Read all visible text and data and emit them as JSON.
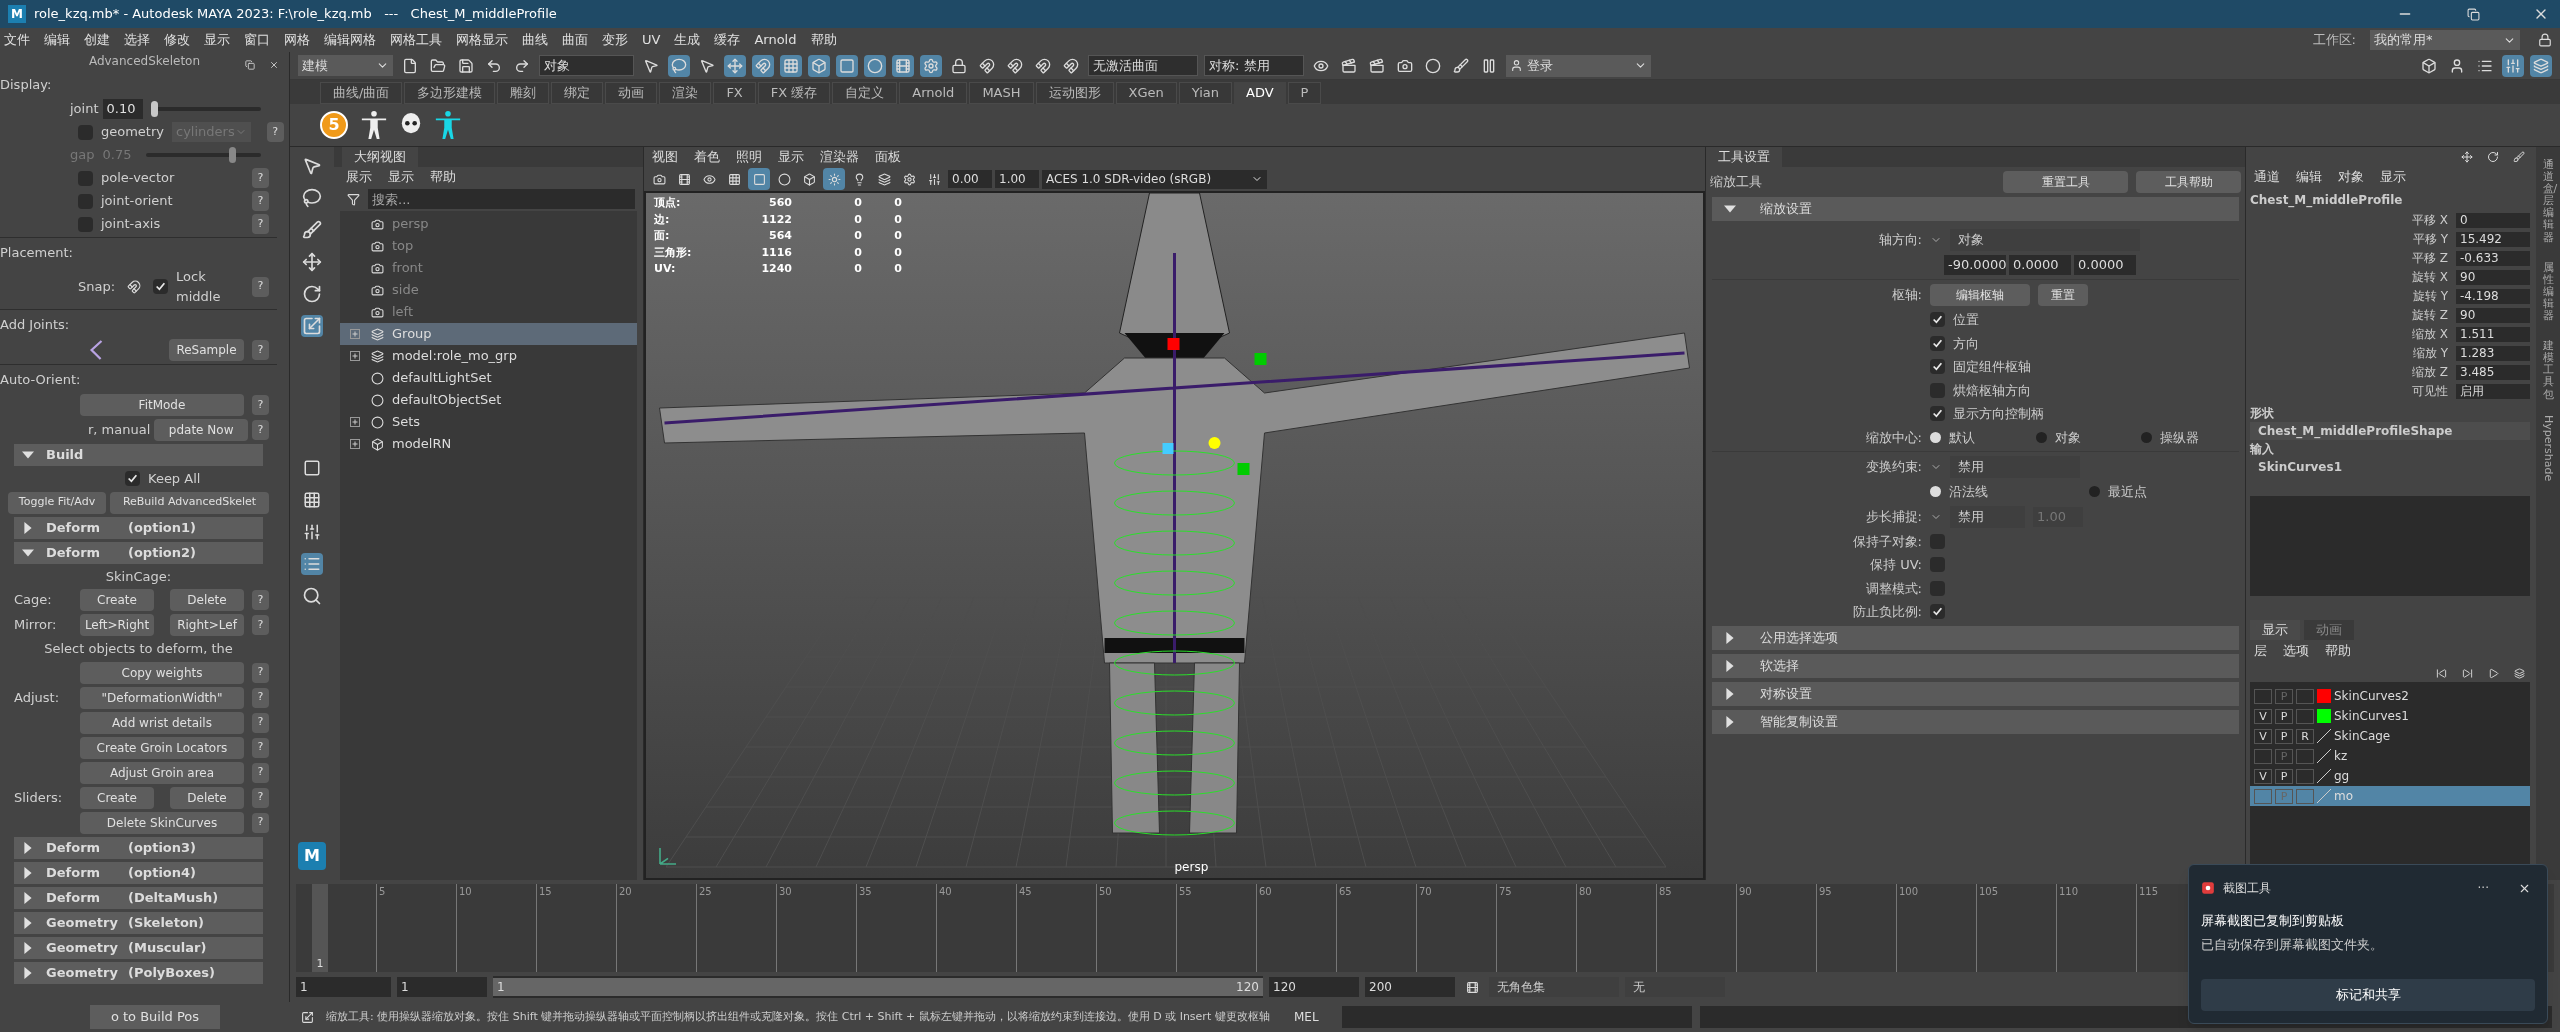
{
  "window": {
    "app_icon": "M",
    "title": "role_kzq.mb* - Autodesk MAYA 2023: F:\\role_kzq.mb   ---   Chest_M_middleProfile"
  },
  "menu_bar": [
    "文件",
    "编辑",
    "创建",
    "选择",
    "修改",
    "显示",
    "窗口",
    "网格",
    "编辑网格",
    "网格工具",
    "网格显示",
    "曲线",
    "曲面",
    "变形",
    "UV",
    "生成",
    "缓存",
    "Arnold",
    "帮助"
  ],
  "workspace": {
    "label": "工作区:",
    "value": "我的常用*"
  },
  "status_line": {
    "mode": "建模",
    "selection_mode": "对象",
    "live_surface": "无激活曲面",
    "symmetry": "对称: 禁用",
    "login": "登录"
  },
  "shelf": {
    "tabs": [
      {
        "label": "曲线/曲面",
        "selected": false
      },
      {
        "label": "多边形建模",
        "selected": false
      },
      {
        "label": "雕刻",
        "selected": false
      },
      {
        "label": "绑定",
        "selected": false
      },
      {
        "label": "动画",
        "selected": false
      },
      {
        "label": "渲染",
        "selected": false
      },
      {
        "label": "FX",
        "selected": false
      },
      {
        "label": "FX 缓存",
        "selected": false
      },
      {
        "label": "自定义",
        "selected": false
      },
      {
        "label": "Arnold",
        "selected": false
      },
      {
        "label": "MASH",
        "selected": false
      },
      {
        "label": "运动图形",
        "selected": false
      },
      {
        "label": "XGen",
        "selected": false
      },
      {
        "label": "Yian",
        "selected": false
      },
      {
        "label": "ADV",
        "selected": true
      },
      {
        "label": "P",
        "selected": false
      }
    ],
    "badge": "5"
  },
  "advanced_skeleton": {
    "title": "AdvancedSkeleton",
    "rows": [
      {
        "kind": "heading",
        "text": "Display:"
      },
      {
        "kind": "slider",
        "label": "joint",
        "value": "0.10",
        "level": 0.03,
        "disabled": false
      },
      {
        "kind": "checkbox_dropdown",
        "label": "geometry",
        "option": "cylinders",
        "checked": false,
        "help": "?"
      },
      {
        "kind": "slider",
        "label": "gap",
        "value": "0.75",
        "level": 0.75,
        "disabled": true
      },
      {
        "kind": "checkbox",
        "label": "pole-vector",
        "checked": false,
        "help": "?"
      },
      {
        "kind": "checkbox",
        "label": "joint-orient",
        "checked": false,
        "help": "?"
      },
      {
        "kind": "checkbox",
        "label": "joint-axis",
        "checked": false,
        "help": "?"
      },
      {
        "kind": "heading",
        "text": "Placement:"
      },
      {
        "kind": "snap",
        "label": "Snap:",
        "checkbox_label": "Lock middle",
        "checked": true,
        "help": "?"
      },
      {
        "kind": "heading",
        "text": "Add Joints:"
      },
      {
        "kind": "icon_button",
        "button": "ReSample",
        "help": "?"
      },
      {
        "kind": "heading",
        "text": "Auto-Orient:"
      },
      {
        "kind": "button",
        "button": "FitMode",
        "help": "?"
      },
      {
        "kind": "label_button",
        "text": "r, manual",
        "button": "pdate Now",
        "help": "?"
      },
      {
        "kind": "section",
        "name": "Build",
        "option": "",
        "expanded": true
      },
      {
        "kind": "checkbox_center",
        "label": "Keep All",
        "checked": true
      },
      {
        "kind": "wide_buttons",
        "buttons": [
          "Toggle Fit/Adv",
          "ReBuild AdvancedSkelet"
        ]
      },
      {
        "kind": "section",
        "name": "Deform",
        "option": "(option1)",
        "expanded": false
      },
      {
        "kind": "section",
        "name": "Deform",
        "option": "(option2)",
        "expanded": true
      },
      {
        "kind": "subheading",
        "text": "SkinCage:"
      },
      {
        "kind": "buttons",
        "label": "Cage:",
        "buttons": [
          "Create",
          "Delete"
        ],
        "help": "?"
      },
      {
        "kind": "buttons",
        "label": "Mirror:",
        "buttons": [
          "Left>Right",
          "Right>Lef"
        ],
        "help": "?"
      },
      {
        "kind": "subheading",
        "text": "Select objects to deform, the"
      },
      {
        "kind": "buttons",
        "label": "",
        "buttons": [
          "Copy weights"
        ],
        "help": "?"
      },
      {
        "kind": "buttons",
        "label": "Adjust:",
        "buttons": [
          "\"DeformationWidth\""
        ],
        "help": "?"
      },
      {
        "kind": "buttons",
        "label": "",
        "buttons": [
          "Add wrist details"
        ],
        "help": "?"
      },
      {
        "kind": "buttons",
        "label": "",
        "buttons": [
          "Create Groin Locators"
        ],
        "help": "?"
      },
      {
        "kind": "buttons",
        "label": "",
        "buttons": [
          "Adjust Groin area"
        ],
        "help": "?"
      },
      {
        "kind": "buttons",
        "label": "Sliders:",
        "buttons": [
          "Create",
          "Delete"
        ],
        "help": "?"
      },
      {
        "kind": "buttons",
        "label": "",
        "buttons": [
          "Delete SkinCurves"
        ],
        "help": "?"
      },
      {
        "kind": "section",
        "name": "Deform",
        "option": "(option3)",
        "expanded": false
      },
      {
        "kind": "section",
        "name": "Deform",
        "option": "(option4)",
        "expanded": false
      },
      {
        "kind": "section",
        "name": "Deform",
        "option": "(DeltaMush)",
        "expanded": false
      },
      {
        "kind": "section",
        "name": "Geometry",
        "option": "(Skeleton)",
        "expanded": false
      },
      {
        "kind": "section",
        "name": "Geometry",
        "option": "(Muscular)",
        "expanded": false
      },
      {
        "kind": "section",
        "name": "Geometry",
        "option": "(PolyBoxes)",
        "expanded": false
      }
    ],
    "footer_button": "o to Build Pos"
  },
  "toolbox": {
    "logo": "M"
  },
  "outliner": {
    "title": "大纲视图",
    "menus": [
      "展示",
      "显示",
      "帮助"
    ],
    "search_placeholder": "搜索...",
    "items": [
      {
        "kind": "camera",
        "label": "persp",
        "expandable": false,
        "selected": false
      },
      {
        "kind": "camera",
        "label": "top",
        "expandable": false,
        "selected": false
      },
      {
        "kind": "camera",
        "label": "front",
        "expandable": false,
        "selected": false
      },
      {
        "kind": "camera",
        "label": "side",
        "expandable": false,
        "selected": false
      },
      {
        "kind": "camera",
        "label": "left",
        "expandable": false,
        "selected": false
      },
      {
        "kind": "group",
        "label": "Group",
        "expandable": true,
        "selected": true
      },
      {
        "kind": "group",
        "label": "model:role_mo_grp",
        "expandable": true,
        "selected": false
      },
      {
        "kind": "set",
        "label": "defaultLightSet",
        "expandable": false,
        "selected": false
      },
      {
        "kind": "set",
        "label": "defaultObjectSet",
        "expandable": false,
        "selected": false
      },
      {
        "kind": "set",
        "label": "Sets",
        "expandable": true,
        "selected": false
      },
      {
        "kind": "reference",
        "label": "modelRN",
        "expandable": true,
        "selected": false
      }
    ]
  },
  "viewport": {
    "menus": [
      "视图",
      "着色",
      "照明",
      "显示",
      "渲染器",
      "面板"
    ],
    "exposure": "0.00",
    "gamma": "1.00",
    "color_space": "ACES 1.0 SDR-video (sRGB)",
    "stats": [
      {
        "label": "顶点:",
        "values": [
          "560",
          "0",
          "0"
        ]
      },
      {
        "label": "边:",
        "values": [
          "1122",
          "0",
          "0"
        ]
      },
      {
        "label": "面:",
        "values": [
          "564",
          "0",
          "0"
        ]
      },
      {
        "label": "三角形:",
        "values": [
          "1116",
          "0",
          "0"
        ]
      },
      {
        "label": "UV:",
        "values": [
          "1240",
          "0",
          "0"
        ]
      }
    ],
    "camera": "persp"
  },
  "tool_settings": {
    "tab": "工具设置",
    "tool": "缩放工具",
    "buttons": [
      "重置工具",
      "工具帮助"
    ],
    "section": "缩放设置",
    "axis_label": "轴方向:",
    "axis_value": "对象",
    "axis_values": [
      "-90.0000",
      "0.0000",
      "0.0000"
    ],
    "pivot_label": "枢轴:",
    "pivot_buttons": [
      "编辑枢轴",
      "重置"
    ],
    "pivot_options": [
      {
        "label": "位置",
        "checked": true
      },
      {
        "label": "方向",
        "checked": true
      },
      {
        "label": "固定组件枢轴",
        "checked": true
      },
      {
        "label": "烘焙枢轴方向",
        "checked": false
      },
      {
        "label": "显示方向控制柄",
        "checked": true
      }
    ],
    "center_label": "缩放中心:",
    "center_options": [
      {
        "label": "默认",
        "selected": true
      },
      {
        "label": "对象",
        "selected": false
      },
      {
        "label": "操纵器",
        "selected": false
      }
    ],
    "constraint_label": "变换约束:",
    "constraint_value": "禁用",
    "constraint_options": [
      {
        "label": "沿法线",
        "selected": true
      },
      {
        "label": "最近点",
        "selected": false
      }
    ],
    "step_label": "步长捕捉:",
    "step_value": "禁用",
    "step_amount": "1.00",
    "options": [
      {
        "label": "保持子对象:",
        "checked": false
      },
      {
        "label": "保持 UV:",
        "checked": false
      },
      {
        "label": "调整模式:",
        "checked": false
      },
      {
        "label": "防止负比例:",
        "checked": true
      }
    ],
    "collapsed_sections": [
      "公用选择选项",
      "软选择",
      "对称设置",
      "智能复制设置"
    ]
  },
  "channel_box": {
    "menus": [
      "通道",
      "编辑",
      "对象",
      "显示"
    ],
    "node": "Chest_M_middleProfile",
    "channels": [
      {
        "label": "平移 X",
        "value": "0"
      },
      {
        "label": "平移 Y",
        "value": "15.492"
      },
      {
        "label": "平移 Z",
        "value": "-0.633"
      },
      {
        "label": "旋转 X",
        "value": "90"
      },
      {
        "label": "旋转 Y",
        "value": "-4.198"
      },
      {
        "label": "旋转 Z",
        "value": "90"
      },
      {
        "label": "缩放 X",
        "value": "1.511"
      },
      {
        "label": "缩放 Y",
        "value": "1.283"
      },
      {
        "label": "缩放 Z",
        "value": "3.485"
      },
      {
        "label": "可见性",
        "value": "启用"
      }
    ],
    "shapes_label": "形状",
    "shape": "Chest_M_middleProfileShape",
    "inputs_label": "输入",
    "input": "SkinCurves1"
  },
  "layer_editor": {
    "tabs": [
      {
        "label": "显示",
        "selected": true
      },
      {
        "label": "动画",
        "selected": false
      }
    ],
    "menus": [
      "层",
      "选项",
      "帮助"
    ],
    "layers": [
      {
        "name": "SkinCurves2",
        "p": "P",
        "p_on": false,
        "color": "#ff0000",
        "selected": false
      },
      {
        "name": "SkinCurves1",
        "v": "V",
        "p": "P",
        "p_on": true,
        "color": "#00ff00",
        "selected": false
      },
      {
        "name": "SkinCage",
        "v": "V",
        "p": "P",
        "p_on": true,
        "r": "R",
        "selected": false
      },
      {
        "name": "kz",
        "p": "P",
        "p_on": false,
        "selected": false
      },
      {
        "name": "gg",
        "v": "V",
        "p": "P",
        "p_on": true,
        "selected": false
      },
      {
        "name": "mo",
        "p": "P",
        "p_on": false,
        "selected": true
      }
    ]
  },
  "side_tabs": [
    {
      "label": "通道盒/层编辑器",
      "kind": "cjk"
    },
    {
      "label": "属性编辑器",
      "kind": "cjk"
    },
    {
      "label": "建模工具包",
      "kind": "cjk"
    },
    {
      "label": "Hypershade",
      "kind": "latin"
    }
  ],
  "timeline": {
    "ticks": [
      "5",
      "10",
      "15",
      "20",
      "25",
      "30",
      "35",
      "40",
      "45",
      "50",
      "55",
      "60",
      "65",
      "70",
      "75",
      "80",
      "85",
      "90",
      "95",
      "100",
      "105",
      "110",
      "115"
    ],
    "current_frame": "1"
  },
  "range": {
    "level": 1,
    "start": "1",
    "playback_start": "1",
    "slider_start": "1",
    "slider_end": "120",
    "playback_end": "120",
    "end": "200",
    "character_set": "无角色集",
    "anim_layer": "无"
  },
  "command_line": {
    "language": "MEL",
    "help": "缩放工具: 使用操纵器缩放对象。按住 Shift 键并拖动操纵器轴或平面控制柄以挤出组件或克隆对象。按住 Ctrl + Shift + 鼠标左键并拖动，以将缩放约束到连接边。使用 D 或 Insert 键更改枢轴"
  },
  "notification": {
    "app": "截图工具",
    "more": "···",
    "title": "屏幕截图已复制到剪贴板",
    "body": "已自动保存到屏幕截图文件夹。",
    "button": "标记和共享"
  }
}
